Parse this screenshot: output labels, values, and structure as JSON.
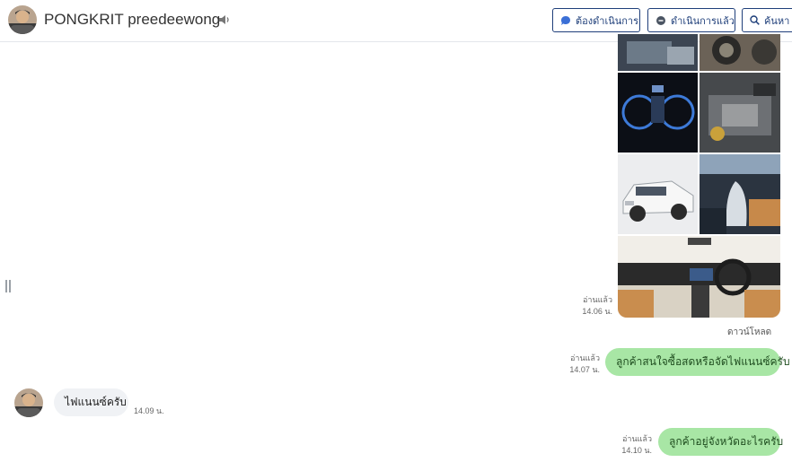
{
  "header": {
    "contact_name": "PONGKRIT preedeewong",
    "buttons": {
      "todo": "ต้องดำเนินการ",
      "done": "ดำเนินการแล้ว",
      "search": "ค้นหา"
    }
  },
  "icons": {
    "speaker": "speaker-icon",
    "todo": "speech-bubble-icon",
    "done": "chat-bubble-icon",
    "search": "magnifier-icon",
    "handle": "drag-handle-icon"
  },
  "colors": {
    "outgoing_bubble": "#a8e6a5",
    "incoming_bubble": "#f0f2f5",
    "button_border": "#1f3f7a"
  },
  "messages": [
    {
      "id": "gallery",
      "direction": "outgoing",
      "type": "image-gallery",
      "read": "อ่านแล้ว",
      "time": "14.06 น.",
      "action": "ดาวน์โหลด"
    },
    {
      "id": "m1",
      "direction": "outgoing",
      "text": "ลูกค้าสนใจซื้อสดหรือจัดไฟแนนซ์ครับ",
      "read": "อ่านแล้ว",
      "time": "14.07 น."
    },
    {
      "id": "m2",
      "direction": "incoming",
      "text": "ไฟแนนซ์ครับ",
      "time": "14.09 น."
    },
    {
      "id": "m3",
      "direction": "outgoing",
      "text": "ลูกค้าอยู่จังหวัดอะไรครับ",
      "read": "อ่านแล้ว",
      "time": "14.10 น."
    }
  ]
}
